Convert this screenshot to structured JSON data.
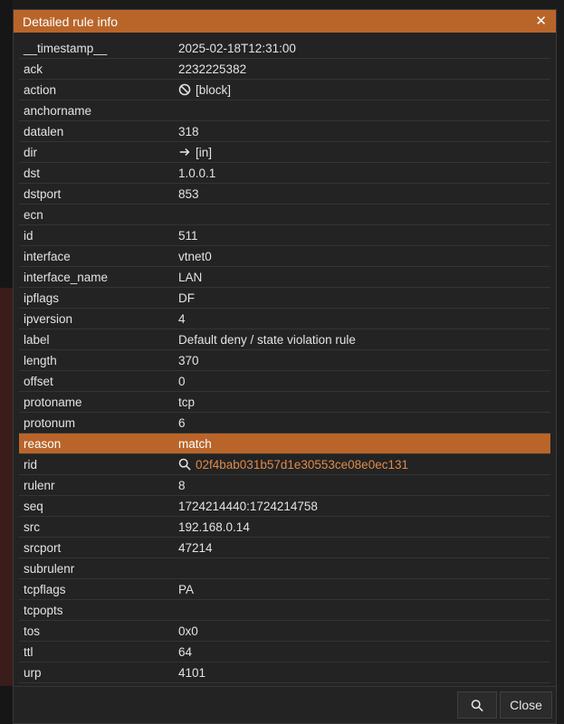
{
  "dialog": {
    "title": "Detailed rule info",
    "close_glyph": "✕"
  },
  "fields": [
    {
      "key": "__timestamp__",
      "value": "2025-02-18T12:31:00"
    },
    {
      "key": "ack",
      "value": "2232225382"
    },
    {
      "key": "action",
      "value": "[block]",
      "icon": "block-icon"
    },
    {
      "key": "anchorname",
      "value": ""
    },
    {
      "key": "datalen",
      "value": "318"
    },
    {
      "key": "dir",
      "value": "[in]",
      "icon": "arrow-right-icon"
    },
    {
      "key": "dst",
      "value": "1.0.0.1"
    },
    {
      "key": "dstport",
      "value": "853"
    },
    {
      "key": "ecn",
      "value": ""
    },
    {
      "key": "id",
      "value": "511"
    },
    {
      "key": "interface",
      "value": "vtnet0"
    },
    {
      "key": "interface_name",
      "value": "LAN"
    },
    {
      "key": "ipflags",
      "value": "DF"
    },
    {
      "key": "ipversion",
      "value": "4"
    },
    {
      "key": "label",
      "value": "Default deny / state violation rule"
    },
    {
      "key": "length",
      "value": "370"
    },
    {
      "key": "offset",
      "value": "0"
    },
    {
      "key": "protoname",
      "value": "tcp"
    },
    {
      "key": "protonum",
      "value": "6"
    },
    {
      "key": "reason",
      "value": "match",
      "highlight": true
    },
    {
      "key": "rid",
      "value": "02f4bab031b57d1e30553ce08e0ec131",
      "icon": "search-icon",
      "link": true
    },
    {
      "key": "rulenr",
      "value": "8"
    },
    {
      "key": "seq",
      "value": "1724214440:1724214758"
    },
    {
      "key": "src",
      "value": "192.168.0.14"
    },
    {
      "key": "srcport",
      "value": "47214"
    },
    {
      "key": "subrulenr",
      "value": ""
    },
    {
      "key": "tcpflags",
      "value": "PA"
    },
    {
      "key": "tcpopts",
      "value": ""
    },
    {
      "key": "tos",
      "value": "0x0"
    },
    {
      "key": "ttl",
      "value": "64"
    },
    {
      "key": "urp",
      "value": "4101"
    }
  ],
  "footer": {
    "search_icon": "search-icon",
    "close_label": "Close"
  },
  "colors": {
    "accent": "#b9652a",
    "link": "#e08a4a",
    "background": "#232323"
  }
}
